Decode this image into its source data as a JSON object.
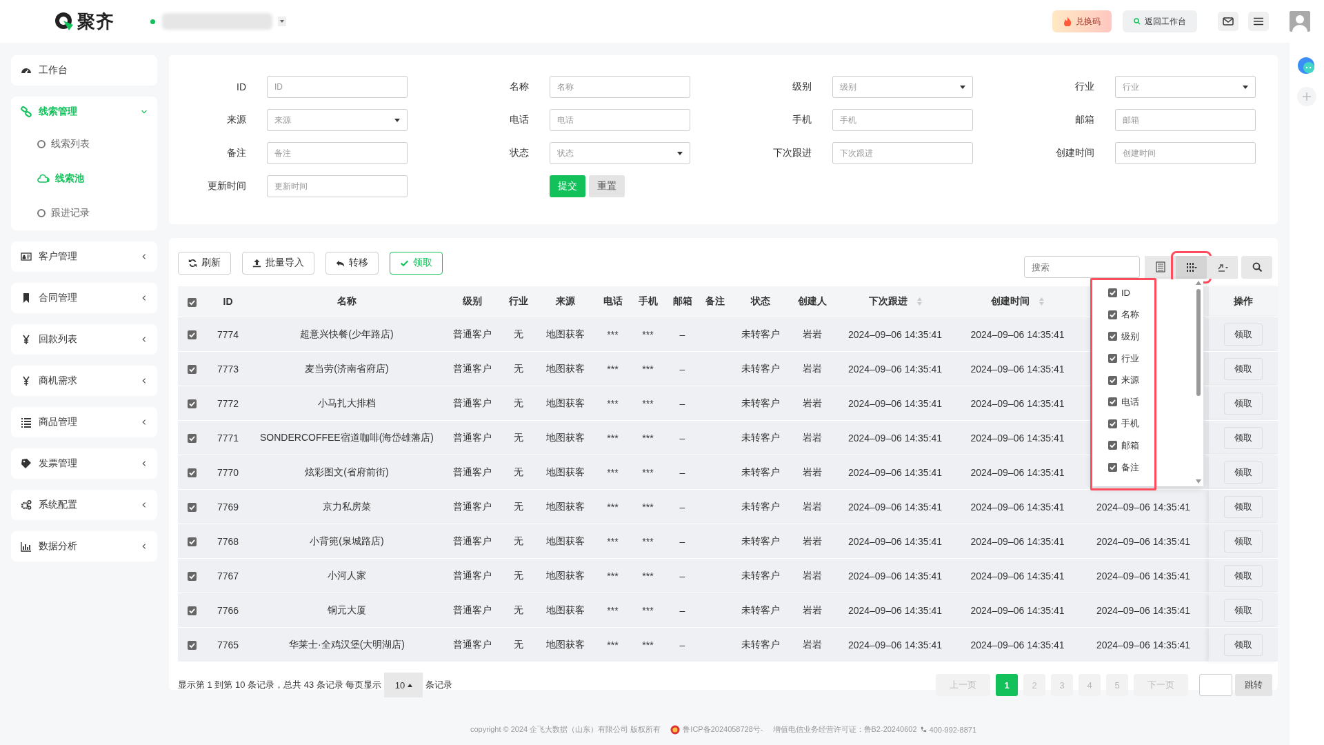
{
  "header": {
    "logo_text": "聚齐",
    "buttons": [
      {
        "label": "兑换码",
        "kind": "promo"
      },
      {
        "label": "返回工作台",
        "kind": "plain"
      }
    ]
  },
  "sidebar": [
    {
      "label": "工作台",
      "selected": false
    },
    {
      "label": "线索管理",
      "expanded": true,
      "selected": true,
      "children": [
        {
          "label": "线索列表",
          "selected": false
        },
        {
          "label": "线索池",
          "selected": true
        },
        {
          "label": "跟进记录",
          "selected": false
        }
      ]
    },
    {
      "label": "客户管理",
      "expanded": false,
      "selected": false
    },
    {
      "label": "合同管理",
      "expanded": false,
      "selected": false
    },
    {
      "label": "回款列表",
      "expanded": false,
      "selected": false
    },
    {
      "label": "商机需求",
      "expanded": false,
      "selected": false
    },
    {
      "label": "商品管理",
      "expanded": false,
      "selected": false
    },
    {
      "label": "发票管理",
      "expanded": false,
      "selected": false
    },
    {
      "label": "系统配置",
      "expanded": false,
      "selected": false
    },
    {
      "label": "数据分析",
      "expanded": false,
      "selected": false
    }
  ],
  "filters": [
    {
      "label": "ID",
      "placeholder": "ID",
      "kind": "text"
    },
    {
      "label": "名称",
      "placeholder": "名称",
      "kind": "text"
    },
    {
      "label": "级别",
      "placeholder": "级别",
      "kind": "select"
    },
    {
      "label": "行业",
      "placeholder": "行业",
      "kind": "select"
    },
    {
      "label": "来源",
      "placeholder": "来源",
      "kind": "select"
    },
    {
      "label": "电话",
      "placeholder": "电话",
      "kind": "text"
    },
    {
      "label": "手机",
      "placeholder": "手机",
      "kind": "text"
    },
    {
      "label": "邮箱",
      "placeholder": "邮箱",
      "kind": "text"
    },
    {
      "label": "备注",
      "placeholder": "备注",
      "kind": "text"
    },
    {
      "label": "状态",
      "placeholder": "状态",
      "kind": "select"
    },
    {
      "label": "下次跟进",
      "placeholder": "下次跟进",
      "kind": "text"
    },
    {
      "label": "创建时间",
      "placeholder": "创建时间",
      "kind": "text"
    },
    {
      "label": "更新时间",
      "placeholder": "更新时间",
      "kind": "text"
    }
  ],
  "filter_buttons": [
    {
      "label": "提交",
      "kind": "primary"
    },
    {
      "label": "重置",
      "kind": "default"
    }
  ],
  "toolbar": [
    {
      "label": "刷新",
      "kind": "default"
    },
    {
      "label": "批量导入",
      "kind": "default"
    },
    {
      "label": "转移",
      "kind": "default"
    },
    {
      "label": "领取",
      "kind": "success"
    }
  ],
  "search": {
    "placeholder": "搜索"
  },
  "view_buttons": [
    {
      "kind": "list",
      "highlighted": false
    },
    {
      "kind": "columns",
      "highlighted": true
    },
    {
      "kind": "export",
      "highlighted": false
    },
    {
      "kind": "search",
      "highlighted": false
    }
  ],
  "table": {
    "all_checked": true,
    "columns": [
      {
        "label": "ID"
      },
      {
        "label": "名称"
      },
      {
        "label": "级别"
      },
      {
        "label": "行业"
      },
      {
        "label": "来源"
      },
      {
        "label": "电话"
      },
      {
        "label": "手机"
      },
      {
        "label": "邮箱"
      },
      {
        "label": "备注"
      },
      {
        "label": "状态"
      },
      {
        "label": "创建人"
      },
      {
        "label": "下次跟进",
        "sortable": true
      },
      {
        "label": "创建时间",
        "sortable": true
      }
    ],
    "action_column": "操作",
    "rows": [
      {
        "checked": true,
        "cells": [
          "7774",
          "超意兴快餐(少年路店)",
          "普通客户",
          "无",
          "地图获客",
          "***",
          "***",
          "–",
          "",
          "未转客户",
          "岩岩",
          "2024–09–06 14:35:41",
          "2024–09–06 14:35:41"
        ],
        "action": "领取"
      },
      {
        "checked": true,
        "cells": [
          "7773",
          "麦当劳(济南省府店)",
          "普通客户",
          "无",
          "地图获客",
          "***",
          "***",
          "–",
          "",
          "未转客户",
          "岩岩",
          "2024–09–06 14:35:41",
          "2024–09–06 14:35:41"
        ],
        "action": "领取"
      },
      {
        "checked": true,
        "cells": [
          "7772",
          "小马扎大排档",
          "普通客户",
          "无",
          "地图获客",
          "***",
          "***",
          "–",
          "",
          "未转客户",
          "岩岩",
          "2024–09–06 14:35:41",
          "2024–09–06 14:35:41"
        ],
        "action": "领取"
      },
      {
        "checked": true,
        "cells": [
          "7771",
          "SONDERCOFFEE宿道咖啡(海岱雄藩店)",
          "普通客户",
          "无",
          "地图获客",
          "***",
          "***",
          "–",
          "",
          "未转客户",
          "岩岩",
          "2024–09–06 14:35:41",
          "2024–09–06 14:35:41"
        ],
        "action": "领取"
      },
      {
        "checked": true,
        "cells": [
          "7770",
          "炫彩图文(省府前街)",
          "普通客户",
          "无",
          "地图获客",
          "***",
          "***",
          "–",
          "",
          "未转客户",
          "岩岩",
          "2024–09–06 14:35:41",
          "2024–09–06 14:35:41"
        ],
        "action": "领取"
      },
      {
        "checked": true,
        "cells": [
          "7769",
          "京力私房菜",
          "普通客户",
          "无",
          "地图获客",
          "***",
          "***",
          "–",
          "",
          "未转客户",
          "岩岩",
          "2024–09–06 14:35:41",
          "2024–09–06 14:35:41"
        ],
        "column_15": "2024–09–06 14:35:41",
        "action": "领取"
      },
      {
        "checked": true,
        "cells": [
          "7768",
          "小背篼(泉城路店)",
          "普通客户",
          "无",
          "地图获客",
          "***",
          "***",
          "–",
          "",
          "未转客户",
          "岩岩",
          "2024–09–06 14:35:41",
          "2024–09–06 14:35:41"
        ],
        "column_15": "2024–09–06 14:35:41",
        "action": "领取"
      },
      {
        "checked": true,
        "cells": [
          "7767",
          "小河人家",
          "普通客户",
          "无",
          "地图获客",
          "***",
          "***",
          "–",
          "",
          "未转客户",
          "岩岩",
          "2024–09–06 14:35:41",
          "2024–09–06 14:35:41"
        ],
        "column_15": "2024–09–06 14:35:41",
        "action": "领取"
      },
      {
        "checked": true,
        "cells": [
          "7766",
          "铜元大厦",
          "普通客户",
          "无",
          "地图获客",
          "***",
          "***",
          "–",
          "",
          "未转客户",
          "岩岩",
          "2024–09–06 14:35:41",
          "2024–09–06 14:35:41"
        ],
        "column_15": "2024–09–06 14:35:41",
        "action": "领取"
      },
      {
        "checked": true,
        "cells": [
          "7765",
          "华莱士·全鸡汉堡(大明湖店)",
          "普通客户",
          "无",
          "地图获客",
          "***",
          "***",
          "–",
          "",
          "未转客户",
          "岩岩",
          "2024–09–06 14:35:41",
          "2024–09–06 14:35:41"
        ],
        "column_15": "2024–09–06 14:35:41",
        "action": "领取"
      }
    ]
  },
  "column_picker": {
    "open": true,
    "highlighted": true,
    "items": [
      {
        "label": "ID",
        "checked": true
      },
      {
        "label": "名称",
        "checked": true
      },
      {
        "label": "级别",
        "checked": true
      },
      {
        "label": "行业",
        "checked": true
      },
      {
        "label": "来源",
        "checked": true
      },
      {
        "label": "电话",
        "checked": true
      },
      {
        "label": "手机",
        "checked": true
      },
      {
        "label": "邮箱",
        "checked": true
      },
      {
        "label": "备注",
        "checked": true
      }
    ]
  },
  "pagination": {
    "summary": "显示第 1 到第 10 条记录，总共 43 条记录 每页显示",
    "page_size": "10",
    "suffix": "条记录",
    "prev": "上一页",
    "pages": [
      {
        "label": "1",
        "selected": true
      },
      {
        "label": "2",
        "selected": false
      },
      {
        "label": "3",
        "selected": false
      },
      {
        "label": "4",
        "selected": false
      },
      {
        "label": "5",
        "selected": false
      }
    ],
    "next": "下一页",
    "jump": "跳转"
  },
  "footer": {
    "copyright": "copyright © 2024 企飞大数据（山东）有限公司 版权所有",
    "icp": "鲁ICP备2024058728号-",
    "license": "增值电信业务经营许可证：鲁B2-20240602",
    "phone": "400-992-8871"
  }
}
